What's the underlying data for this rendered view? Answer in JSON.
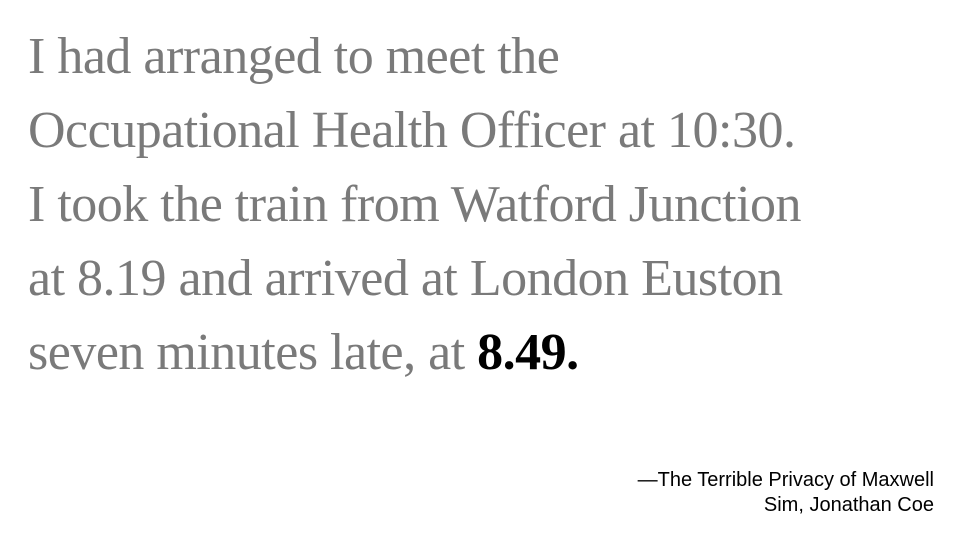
{
  "quote": {
    "lines": [
      "I had arranged to meet the",
      "Occupational Health Officer at 10:30.",
      "I took the train from Watford Junction",
      "at 8.19 and arrived at London Euston",
      "seven minutes late, at "
    ],
    "emphasis": "8.49.",
    "text_color": "#7a7a7a",
    "emphasis_color": "#000000"
  },
  "attribution": {
    "line1": "—The Terrible Privacy of Maxwell",
    "line2": "Sim, Jonathan Coe"
  }
}
